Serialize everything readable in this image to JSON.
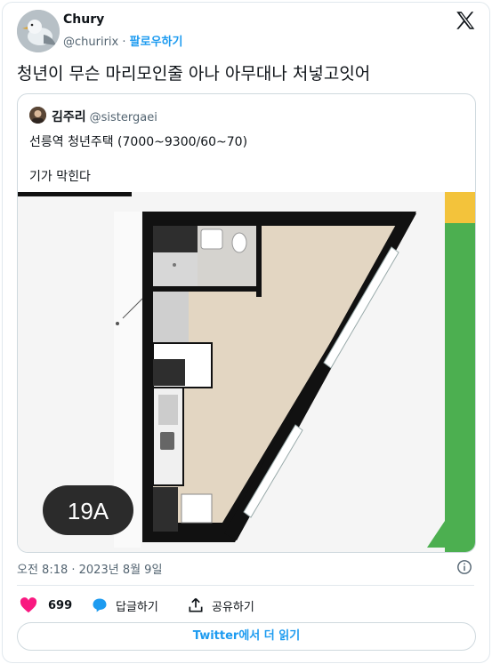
{
  "author": {
    "name": "Chury",
    "handle": "@churirix",
    "separator": "·",
    "follow_label": "팔로우하기"
  },
  "tweet": {
    "text": "청년이 무슨 마리모인줄 아나 아무대나 처넣고잇어"
  },
  "quoted": {
    "name": "김주리",
    "handle": "@sistergaei",
    "line1": "선릉역 청년주택 (7000~9300/60~70)",
    "line2": "기가 막힌다",
    "plan_label": "19A"
  },
  "meta": {
    "timestamp": "오전 8:18 · 2023년 8월 9일"
  },
  "actions": {
    "likes": "699",
    "reply_label": "답글하기",
    "share_label": "공유하기"
  },
  "read_more": {
    "brand": "Twitter",
    "rest": "에서 더 읽기"
  },
  "colors": {
    "like": "#f91880",
    "link": "#1d9bf0",
    "muted": "#536471",
    "plan_green": "#4caf50",
    "plan_yellow": "#f3c33b",
    "floor": "#e3d6c2",
    "wall": "#111111"
  },
  "icons": [
    "bird-avatar-icon",
    "x-logo-icon",
    "info-icon",
    "heart-icon",
    "reply-bubble-icon",
    "share-upload-icon"
  ]
}
